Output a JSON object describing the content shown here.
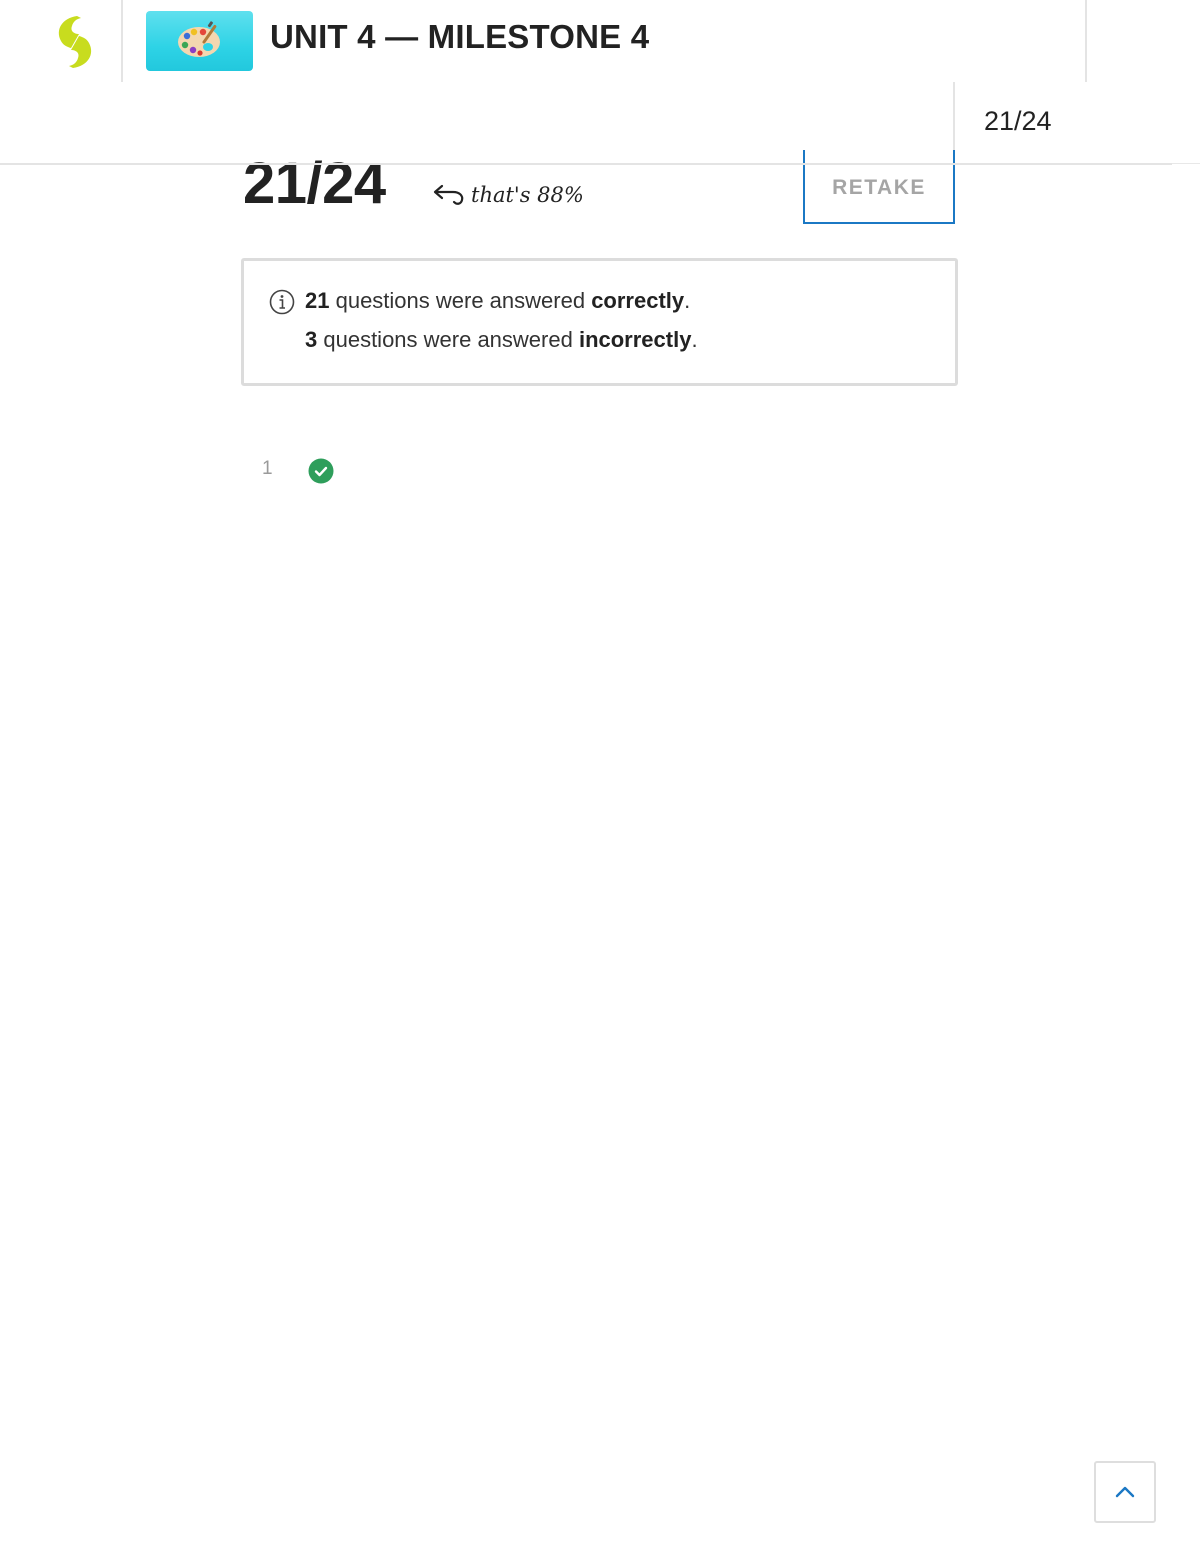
{
  "header": {
    "title": "UNIT 4 — MILESTONE 4",
    "logo_icon": "sophia-logo-icon",
    "thumbnail_icon": "paint-palette-icon",
    "brand_color": "#c8dc1e",
    "thumbnail_color": "#2ed3e6"
  },
  "subheader": {
    "score": "21/24"
  },
  "result": {
    "score": "21/24",
    "percent_note": "that's 88%",
    "retake_label": "RETAKE",
    "accent_color": "#1b78c4"
  },
  "summary": {
    "correct_count": "21",
    "correct_text": " questions were answered ",
    "correct_word": "correctly",
    "incorrect_count": "3",
    "incorrect_text": " questions were answered ",
    "incorrect_word": "incorrectly",
    "period": ".",
    "icon": "info-icon"
  },
  "questions": [
    {
      "number": "1",
      "status": "correct",
      "status_color": "#2e9e5b"
    }
  ],
  "scroll_top_icon": "chevron-up-icon"
}
